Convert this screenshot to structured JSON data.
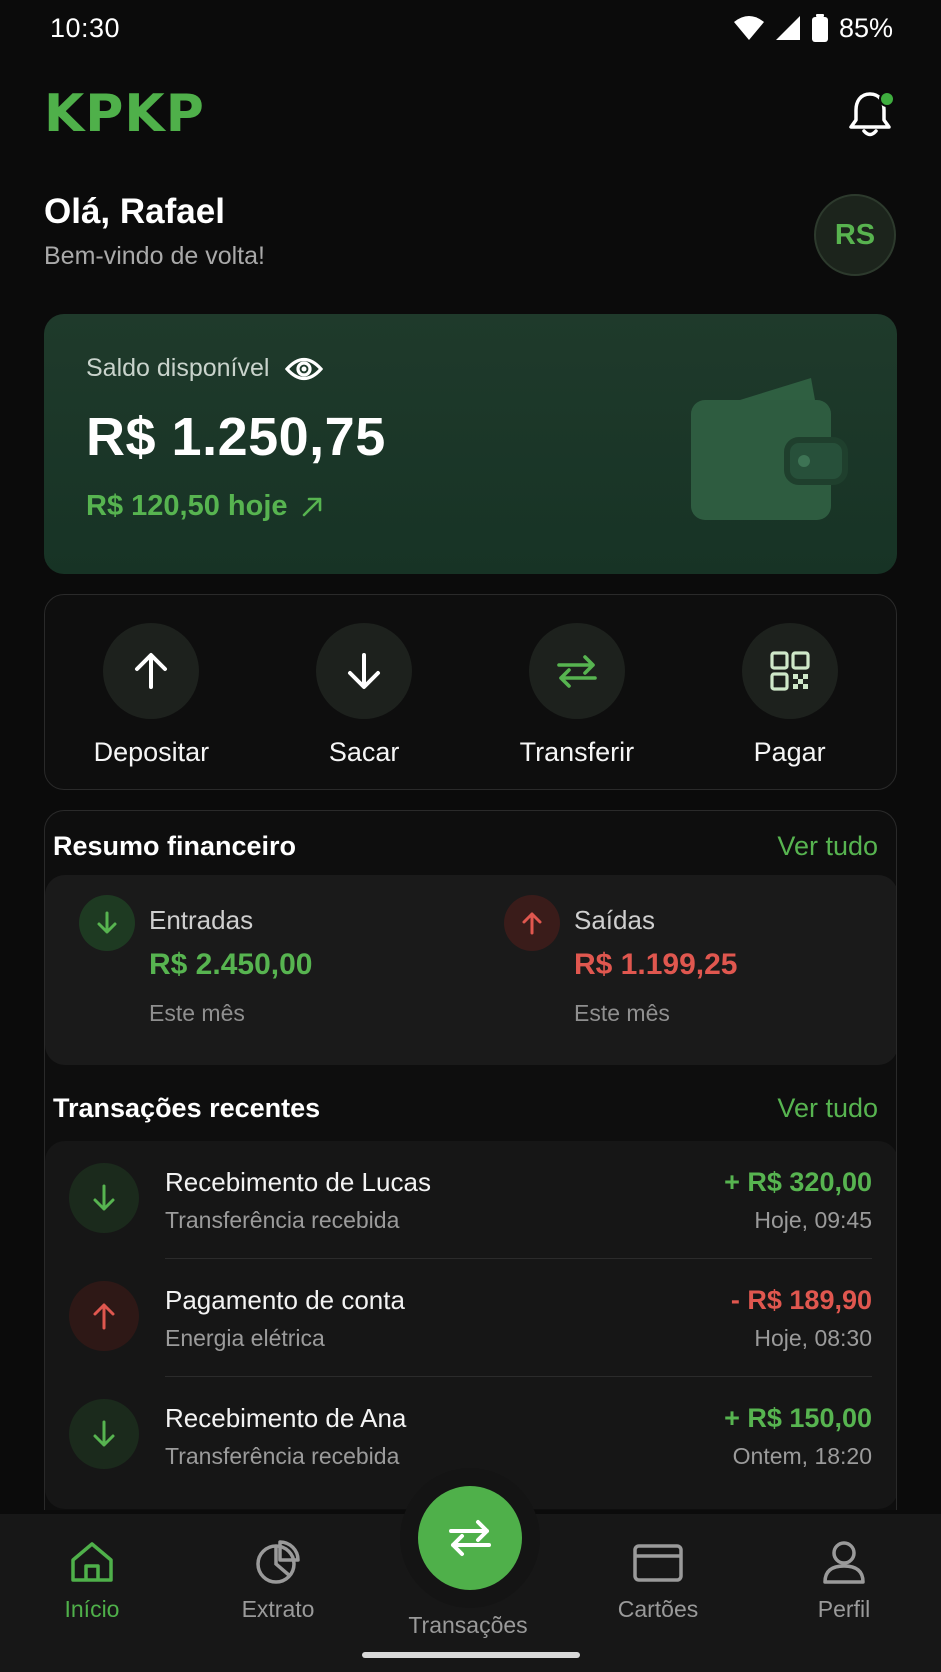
{
  "status": {
    "time": "10:30",
    "battery": "85%"
  },
  "header": {
    "logo": "KPKP"
  },
  "user": {
    "greeting": "Olá, Rafael",
    "subtitle": "Bem-vindo de volta!",
    "initials": "RS"
  },
  "balance": {
    "label": "Saldo disponível",
    "value": "R$ 1.250,75",
    "today": "R$ 120,50 hoje"
  },
  "actions": [
    {
      "label": "Depositar",
      "icon": "arrow-up-icon"
    },
    {
      "label": "Sacar",
      "icon": "arrow-down-icon"
    },
    {
      "label": "Transferir",
      "icon": "transfer-icon"
    },
    {
      "label": "Pagar",
      "icon": "qr-code-icon"
    }
  ],
  "summary": {
    "title": "Resumo financeiro",
    "see_all": "Ver tudo",
    "income": {
      "label": "Entradas",
      "value": "R$ 2.450,00",
      "period": "Este mês"
    },
    "expense": {
      "label": "Saídas",
      "value": "R$ 1.199,25",
      "period": "Este mês"
    }
  },
  "transactions": {
    "title": "Transações recentes",
    "see_all": "Ver tudo",
    "items": [
      {
        "title": "Recebimento de Lucas",
        "subtitle": "Transferência recebida",
        "amount": "+ R$ 320,00",
        "time": "Hoje, 09:45",
        "type": "income"
      },
      {
        "title": "Pagamento de conta",
        "subtitle": "Energia elétrica",
        "amount": "- R$ 189,90",
        "time": "Hoje, 08:30",
        "type": "expense"
      },
      {
        "title": "Recebimento de Ana",
        "subtitle": "Transferência recebida",
        "amount": "+ R$ 150,00",
        "time": "Ontem, 18:20",
        "type": "income"
      }
    ]
  },
  "nav": {
    "items": [
      {
        "label": "Início",
        "icon": "home-icon",
        "active": true
      },
      {
        "label": "Extrato",
        "icon": "pie-chart-icon",
        "active": false
      },
      {
        "label": "Transações",
        "icon": "transfer-icon",
        "active": false
      },
      {
        "label": "Cartões",
        "icon": "card-icon",
        "active": false
      },
      {
        "label": "Perfil",
        "icon": "user-icon",
        "active": false
      }
    ]
  },
  "colors": {
    "accent": "#4fb04a",
    "income": "#57b450",
    "expense": "#e0574f",
    "background": "#0b0b0b"
  }
}
